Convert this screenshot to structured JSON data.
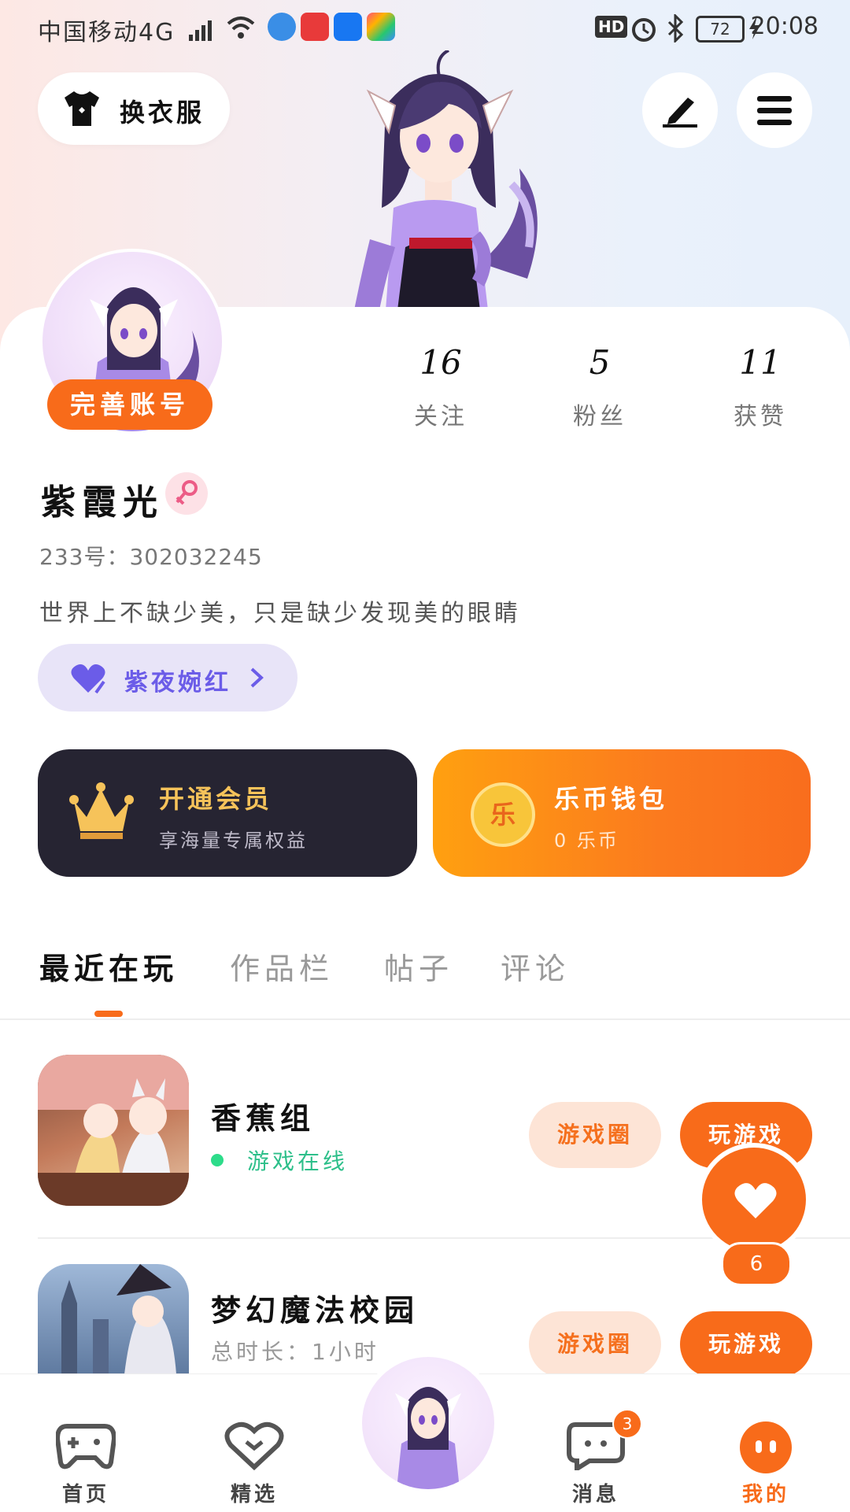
{
  "status": {
    "carrier": "中国移动4G",
    "network": "4G",
    "battery": "72",
    "time": "20:08",
    "hd": "HD"
  },
  "header": {
    "outfit_label": "换衣服",
    "edit_icon": "pen-icon",
    "menu_icon": "menu-icon"
  },
  "profile": {
    "complete_account_label": "完善账号",
    "name": "紫霞光",
    "gender_icon": "female-icon",
    "id_label": "233号：302032245",
    "bio": "世界上不缺少美，只是缺少发现美的眼睛",
    "badge_label": "紫夜婉红",
    "stats": [
      {
        "value": "16",
        "label": "关注"
      },
      {
        "value": "5",
        "label": "粉丝"
      },
      {
        "value": "11",
        "label": "获赞"
      }
    ]
  },
  "promo": {
    "vip_title": "开通会员",
    "vip_sub": "享海量专属权益",
    "coin_title": "乐币钱包",
    "coin_sub": "0 乐币",
    "coin_glyph": "乐"
  },
  "tabs": [
    "最近在玩",
    "作品栏",
    "帖子",
    "评论"
  ],
  "games": [
    {
      "title": "香蕉组",
      "sub": "游戏在线",
      "circle_label": "游戏圈",
      "play_label": "玩游戏"
    },
    {
      "title": "梦幻魔法校园",
      "sub": "总时长：1小时",
      "circle_label": "游戏圈",
      "play_label": "玩游戏"
    }
  ],
  "float_like": {
    "count": "6"
  },
  "nav": {
    "items": [
      {
        "label": "首页"
      },
      {
        "label": "精选"
      },
      {
        "label": "消息",
        "badge": "3"
      },
      {
        "label": "我的"
      }
    ]
  },
  "colors": {
    "accent": "#f86b1a",
    "vip_bg": "#262432",
    "badge_bg": "#e8e4f8",
    "online": "#2dbf8a"
  }
}
